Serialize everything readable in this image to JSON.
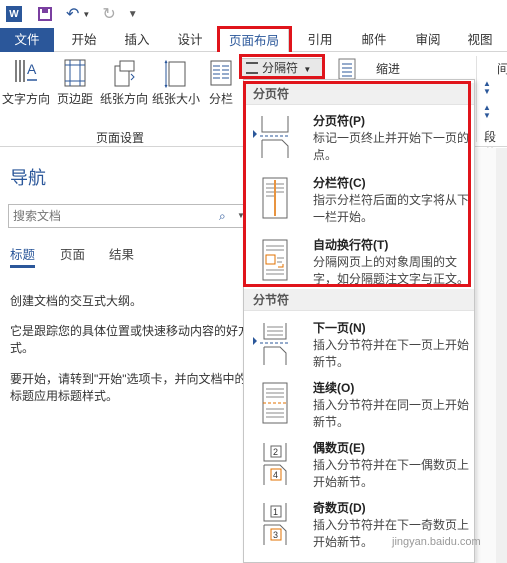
{
  "titlebar": {
    "logo": "W"
  },
  "tabs": [
    "文件",
    "开始",
    "插入",
    "设计",
    "页面布局",
    "引用",
    "邮件",
    "审阅",
    "视图"
  ],
  "ribbon": {
    "buttons": [
      "文字方向",
      "页边距",
      "纸张方向",
      "纸张大小",
      "分栏"
    ],
    "breaks_label": "分隔符",
    "group_label": "页面设置",
    "indent_label": "缩进",
    "spacing_label": "间",
    "paragraph_label": "段落"
  },
  "nav": {
    "title": "导航",
    "search_placeholder": "搜索文档",
    "tabs": [
      "标题",
      "页面",
      "结果"
    ],
    "paragraphs": [
      "创建文档的交互式大纲。",
      "它是跟踪您的具体位置或快速移动内容的好方式。",
      "要开始，请转到\"开始\"选项卡，并向文档中的标题应用标题样式。"
    ]
  },
  "menu": {
    "section_page": "分页符",
    "section_section": "分节符",
    "items": [
      {
        "title": "分页符(P)",
        "desc": "标记一页终止并开始下一页的点。"
      },
      {
        "title": "分栏符(C)",
        "desc": "指示分栏符后面的文字将从下一栏开始。"
      },
      {
        "title": "自动换行符(T)",
        "desc": "分隔网页上的对象周围的文字，如分隔题注文字与正文。"
      },
      {
        "title": "下一页(N)",
        "desc": "插入分节符并在下一页上开始新节。"
      },
      {
        "title": "连续(O)",
        "desc": "插入分节符并在同一页上开始新节。"
      },
      {
        "title": "偶数页(E)",
        "desc": "插入分节符并在下一偶数页上开始新节。"
      },
      {
        "title": "奇数页(D)",
        "desc": "插入分节符并在下一奇数页上开始新节。"
      }
    ]
  },
  "watermark": "jingyan.baidu.com",
  "colors": {
    "accent": "#2b579a",
    "highlight": "#e0141b",
    "file_tab": "#2b579a"
  }
}
